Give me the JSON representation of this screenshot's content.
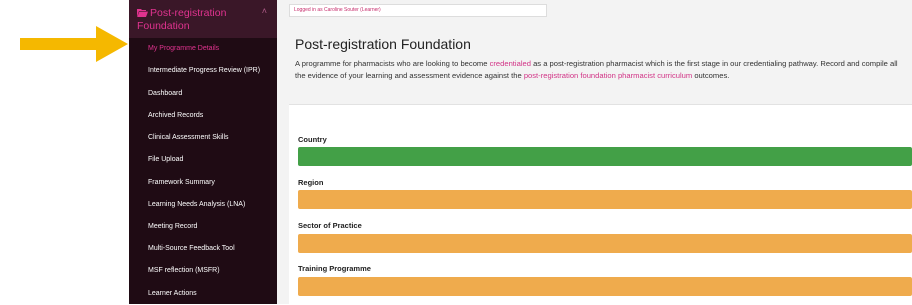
{
  "sidebar": {
    "header": {
      "title": "Post-registration Foundation",
      "icon": "folder-open-icon"
    },
    "items": [
      {
        "label": "My Programme Details",
        "active": true
      },
      {
        "label": "Intermediate Progress Review (IPR)",
        "active": false
      },
      {
        "label": "Dashboard",
        "active": false
      },
      {
        "label": "Archived Records",
        "active": false
      },
      {
        "label": "Clinical Assessment Skills",
        "active": false
      },
      {
        "label": "File Upload",
        "active": false
      },
      {
        "label": "Framework Summary",
        "active": false
      },
      {
        "label": "Learning Needs Analysis (LNA)",
        "active": false
      },
      {
        "label": "Meeting Record",
        "active": false
      },
      {
        "label": "Multi-Source Feedback Tool",
        "active": false
      },
      {
        "label": "MSF reflection (MSFR)",
        "active": false
      },
      {
        "label": "Learner Actions",
        "active": false
      }
    ]
  },
  "login": {
    "prefix": "Logged in as ",
    "user": "Caroline Souter (Learner)"
  },
  "intro": {
    "title": "Post-registration Foundation",
    "text_1": "A programme for pharmacists who are looking to become ",
    "link_1": "credentialed",
    "text_2": " as a post-registration pharmacist which is the first stage in our credentialing pathway. Record and compile all the evidence of your learning and assessment evidence against the ",
    "link_2": "post-registration foundation pharmacist curriculum",
    "text_3": " outcomes."
  },
  "fields": [
    {
      "label": "Country",
      "color": "#43a047"
    },
    {
      "label": "Region",
      "color": "#efab4d"
    },
    {
      "label": "Sector of Practice",
      "color": "#efab4d"
    },
    {
      "label": "Training Programme",
      "color": "#efab4d"
    }
  ],
  "colors": {
    "accent": "#e0338f",
    "sidebar_bg": "#1f0b14",
    "arrow": "#f5b800"
  }
}
